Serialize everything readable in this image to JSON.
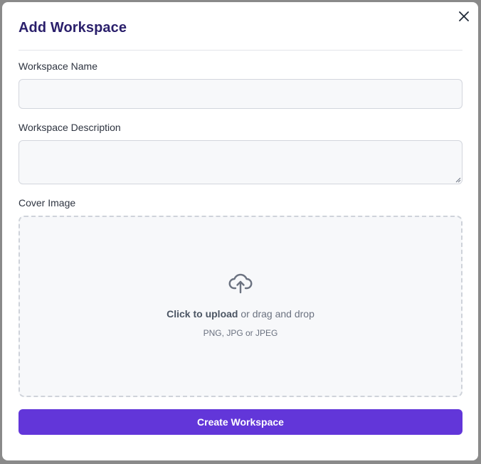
{
  "dialog": {
    "title": "Add Workspace"
  },
  "form": {
    "name": {
      "label": "Workspace Name",
      "value": ""
    },
    "description": {
      "label": "Workspace Description",
      "value": ""
    },
    "cover": {
      "label": "Cover Image",
      "upload_strong": "Click to upload",
      "upload_rest": " or drag and drop",
      "hint": "PNG, JPG or JPEG"
    },
    "submit_label": "Create Workspace"
  },
  "colors": {
    "title": "#2a1f6b",
    "primary": "#6236d9",
    "field_bg": "#f7f8fa",
    "border": "#d3d6dd"
  },
  "icons": {
    "close": "close-icon",
    "upload": "cloud-upload-icon",
    "resize": "resize-grip-icon"
  }
}
